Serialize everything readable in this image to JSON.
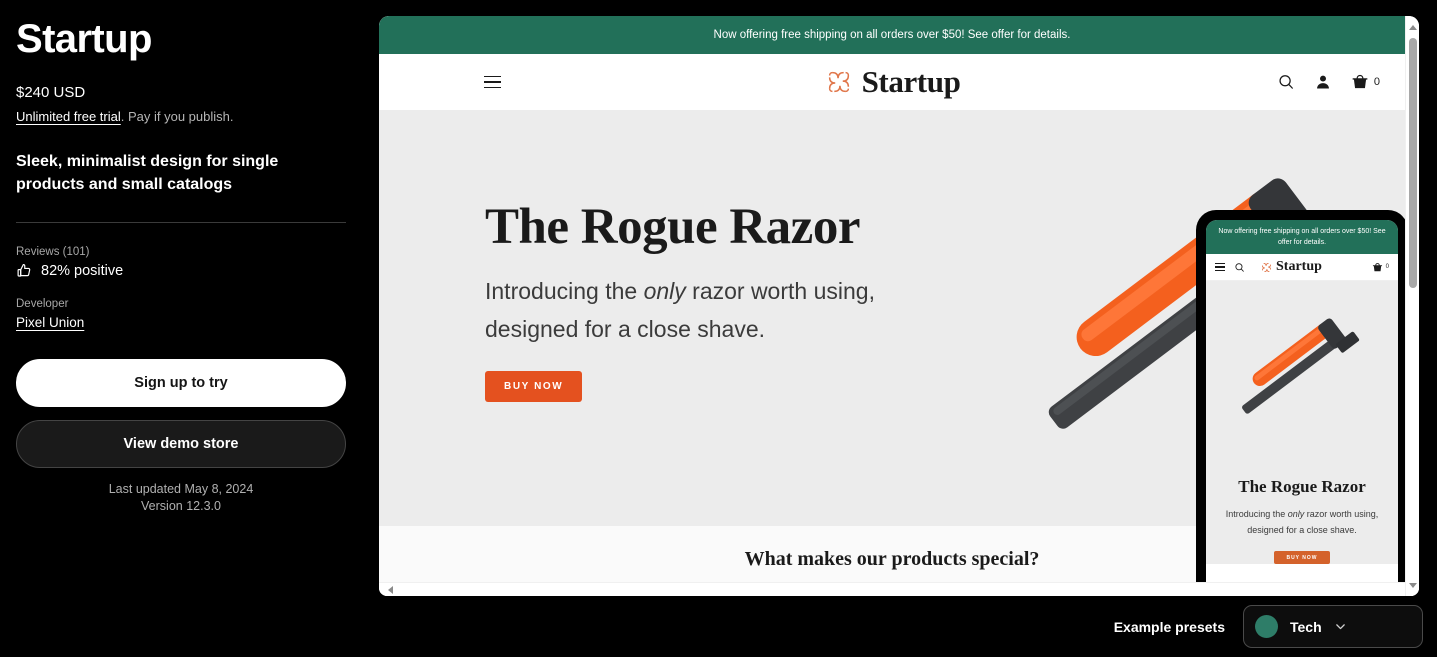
{
  "theme": {
    "title": "Startup",
    "price": "$240 USD",
    "trial_link": "Unlimited free trial",
    "trial_rest": ". Pay if you publish.",
    "tagline": "Sleek, minimalist design for single products and small catalogs",
    "reviews_label": "Reviews (101)",
    "reviews_value": "82% positive",
    "developer_label": "Developer",
    "developer_name": "Pixel Union",
    "signup_button": "Sign up to try",
    "demo_button": "View demo store",
    "last_updated": "Last updated May 8, 2024",
    "version": "Version 12.3.0"
  },
  "preview": {
    "announcement": "Now offering free shipping on all orders over $50! See offer for details.",
    "logo_text": "Startup",
    "cart_count": "0",
    "hero_title": "The Rogue Razor",
    "hero_sub_pre": "Introducing the ",
    "hero_sub_em": "only",
    "hero_sub_post": " razor worth using, designed for a close shave.",
    "buy_label": "BUY NOW",
    "section_heading": "What makes our products special?"
  },
  "mobile": {
    "announcement": "Now offering free shipping on all orders over $50! See offer for details.",
    "logo_text": "Startup",
    "cart_count": "0",
    "hero_title": "The Rogue Razor",
    "hero_sub_pre": "Introducing the ",
    "hero_sub_em": "only",
    "hero_sub_post": " razor worth using, designed for a close shave.",
    "buy_label": "BUY NOW"
  },
  "bottom": {
    "presets_label": "Example presets",
    "selected_preset": "Tech"
  },
  "colors": {
    "announcement_green": "#227059",
    "accent_orange": "#E4511F",
    "preset_dot": "#2E7D68",
    "page_bg": "#000000",
    "hero_bg": "#ececec"
  }
}
